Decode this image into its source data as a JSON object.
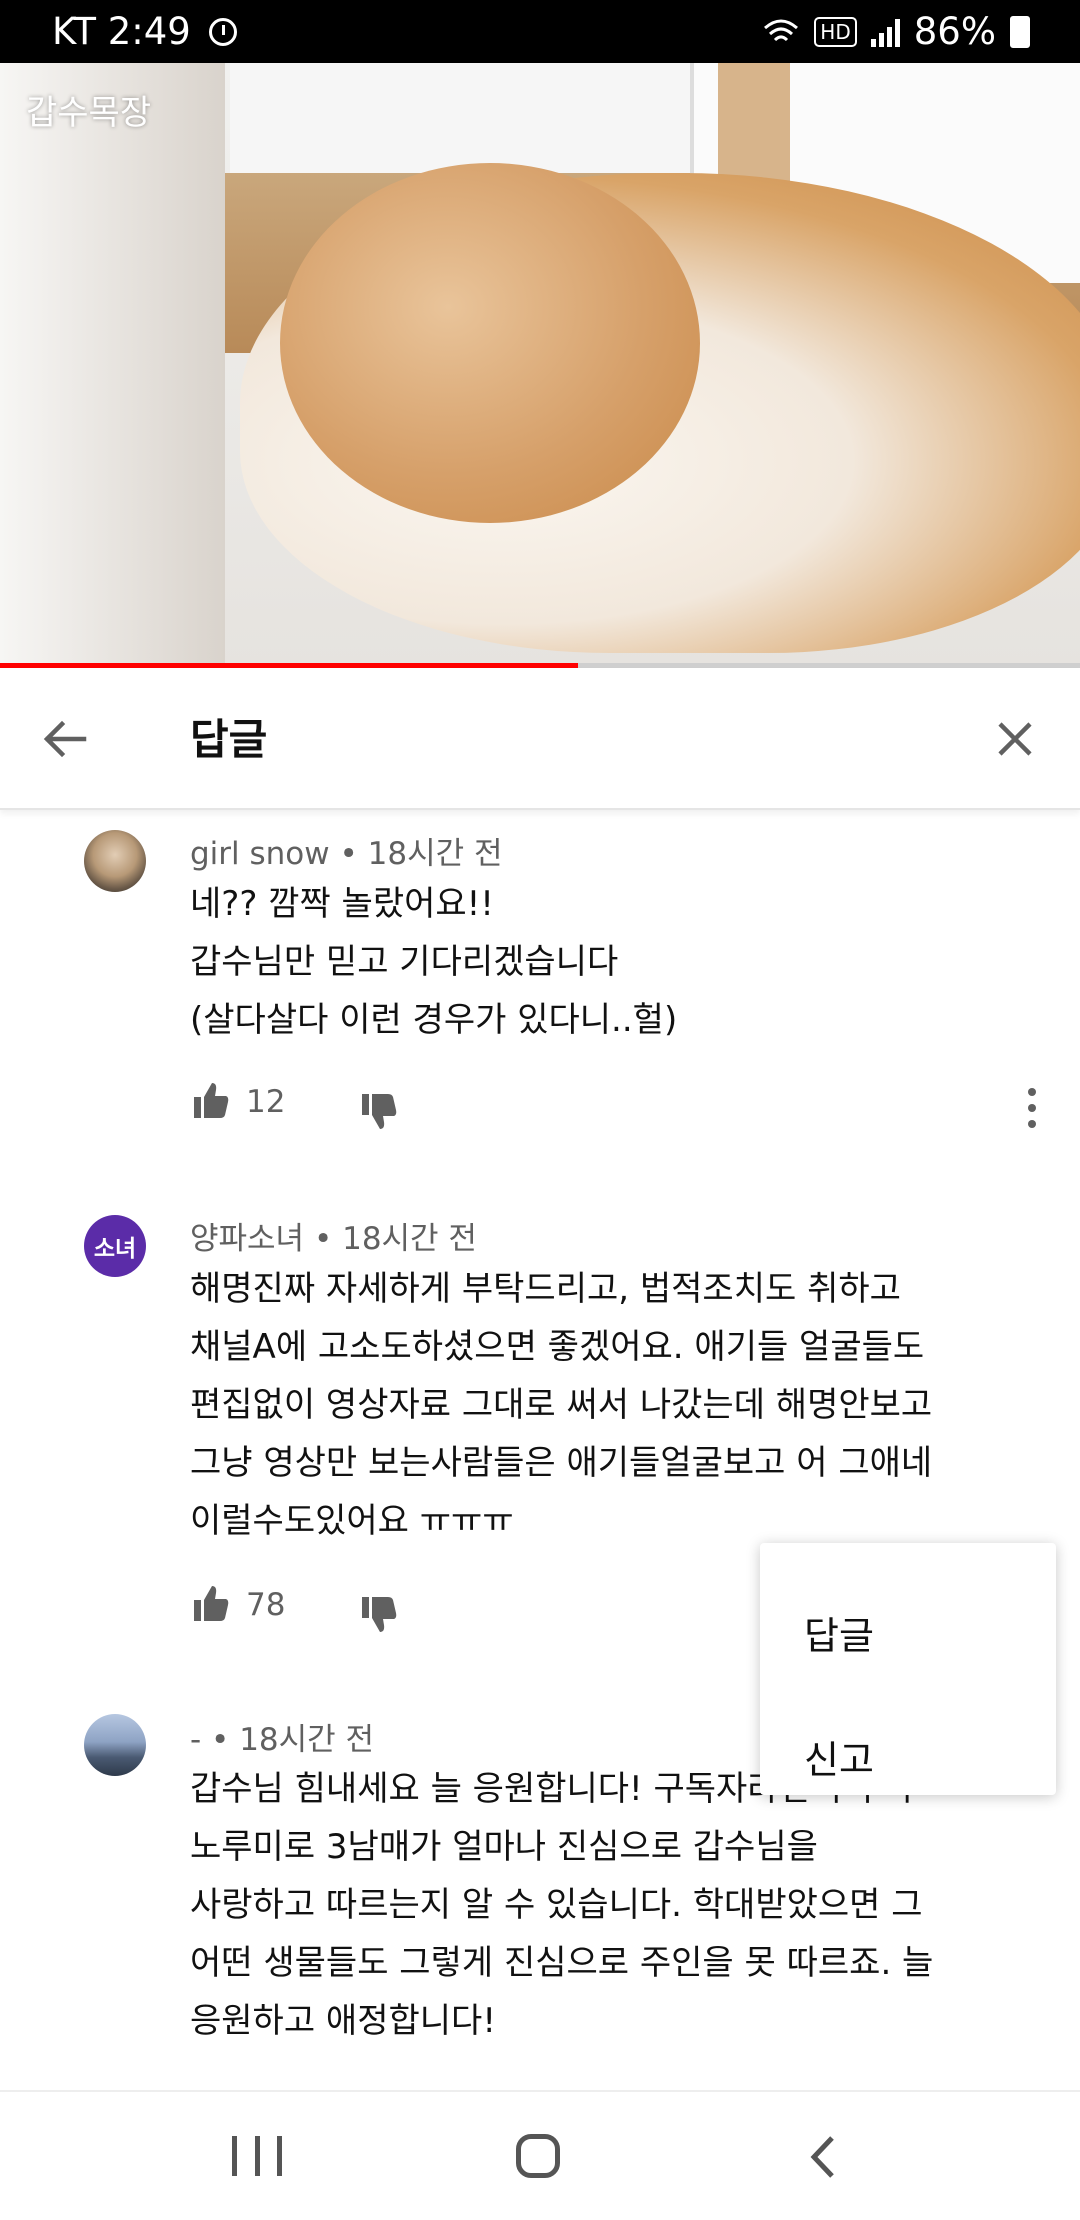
{
  "status_bar": {
    "carrier_time": "KT 2:49",
    "network": "HD",
    "battery": "86%",
    "icons": [
      "alarm-icon",
      "wifi-icon",
      "hd-icon",
      "signal-icon",
      "battery-icon"
    ]
  },
  "video": {
    "watermark": "갑수목장",
    "progress": 0.535,
    "colors": {
      "progress": "#ff0000",
      "track": "#cfcfcf"
    }
  },
  "header": {
    "title": "답글",
    "back_icon": "arrow-left-icon",
    "close_icon": "close-icon"
  },
  "comments": [
    {
      "author": "girl snow",
      "time": "18시간 전",
      "text": "네?? 깜짝 놀랐어요!!\n갑수님만 믿고 기다리겠습니다\n(살다살다 이런 경우가 있다니..헐)",
      "likes": "12"
    },
    {
      "author": "양파소녀",
      "avatar_text": "소녀",
      "time": "18시간 전",
      "text": "해명진짜 자세하게 부탁드리고, 법적조치도 취하고\n채널A에 고소도하셨으면 좋겠어요. 애기들 얼굴들도\n편집없이 영상자료 그대로 써서 나갔는데 해명안보고\n그냥 영상만 보는사람들은 애기들얼굴보고 어 그애네\n이럴수도있어요 ㅠㅠㅠ",
      "likes": "78"
    },
    {
      "author": "-",
      "time": "18시간 전",
      "text": "갑수님 힘내세요 늘 응원합니다! 구독자라면 누구나\n노루미로 3남매가 얼마나 진심으로 갑수님을\n사랑하고 따르는지 알 수 있습니다. 학대받았으면 그\n어떤 생물들도 그렇게 진심으로 주인을 못 따르죠. 늘\n응원하고 애정합니다!"
    }
  ],
  "popup_menu": {
    "items": [
      "답글",
      "신고"
    ]
  },
  "nav": {
    "icons": [
      "recent-apps-icon",
      "home-icon",
      "back-icon"
    ]
  }
}
